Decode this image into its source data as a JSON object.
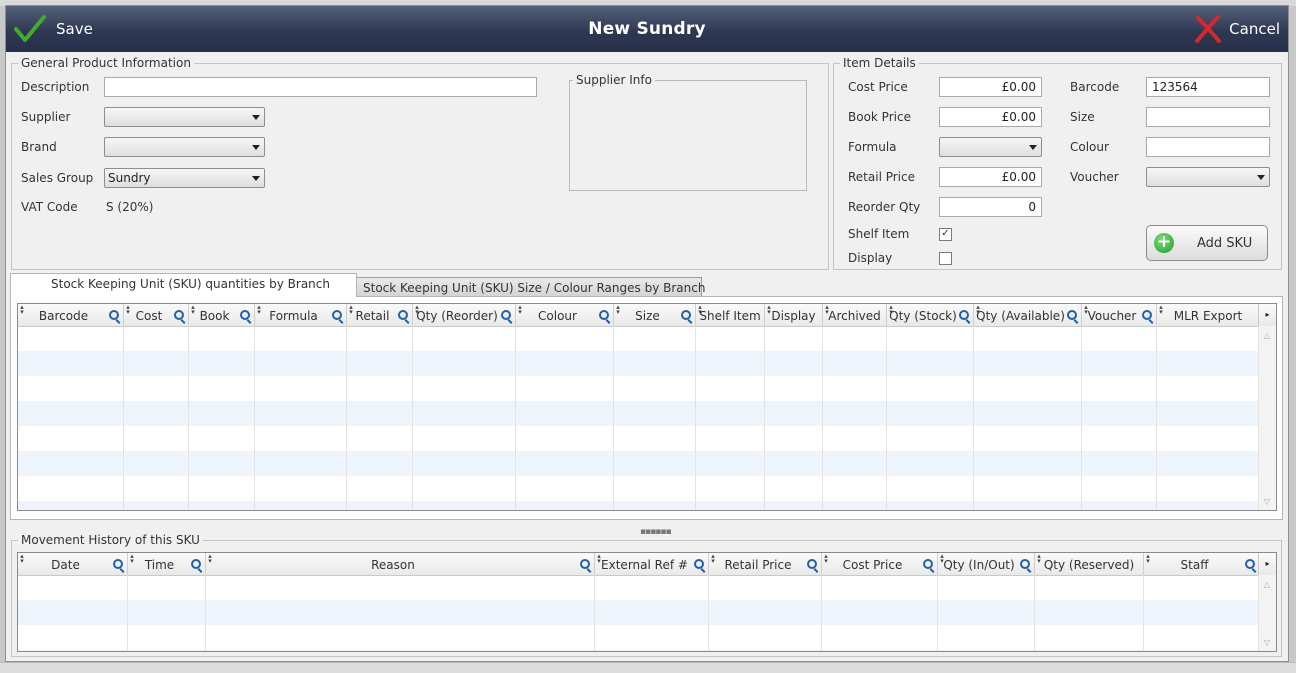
{
  "window": {
    "title": "New Sundry",
    "save_label": "Save",
    "cancel_label": "Cancel"
  },
  "general_info": {
    "group_title": "General Product Information",
    "description_label": "Description",
    "description_value": "",
    "supplier_label": "Supplier",
    "supplier_value": "",
    "brand_label": "Brand",
    "brand_value": "",
    "sales_group_label": "Sales Group",
    "sales_group_value": "Sundry",
    "vat_code_label": "VAT Code",
    "vat_code_value": "S (20%)",
    "supplier_info_title": "Supplier Info"
  },
  "item_details": {
    "group_title": "Item Details",
    "cost_price_label": "Cost Price",
    "cost_price_value": "£0.00",
    "book_price_label": "Book Price",
    "book_price_value": "£0.00",
    "formula_label": "Formula",
    "formula_value": "",
    "retail_price_label": "Retail Price",
    "retail_price_value": "£0.00",
    "reorder_qty_label": "Reorder Qty",
    "reorder_qty_value": "0",
    "shelf_item_label": "Shelf Item",
    "shelf_item_checked": true,
    "display_label": "Display",
    "display_checked": false,
    "barcode_label": "Barcode",
    "barcode_value": "123564",
    "size_label": "Size",
    "size_value": "",
    "colour_label": "Colour",
    "colour_value": "",
    "voucher_label": "Voucher",
    "voucher_value": "",
    "add_sku_label": "Add SKU"
  },
  "tabs": [
    {
      "label": "Stock Keeping Unit (SKU) quantities by Branch",
      "active": true
    },
    {
      "label": "Stock Keeping Unit (SKU) Size / Colour Ranges by Branch",
      "active": false
    }
  ],
  "sku_grid": {
    "columns": [
      "Barcode",
      "Cost",
      "Book",
      "Formula",
      "Retail",
      "Qty (Reorder)",
      "Colour",
      "Size",
      "Shelf Item",
      "Display",
      "Archived",
      "Qty (Stock)",
      "Qty (Available)",
      "Voucher",
      "MLR Export"
    ],
    "searchable": [
      true,
      true,
      true,
      true,
      true,
      true,
      true,
      true,
      false,
      false,
      false,
      true,
      true,
      true,
      false
    ],
    "rows": []
  },
  "movement": {
    "group_title": "Movement History of this SKU",
    "columns": [
      "Date",
      "Time",
      "Reason",
      "External Ref #",
      "Retail Price",
      "Cost Price",
      "Qty (In/Out)",
      "Qty (Reserved)",
      "Staff"
    ],
    "searchable": [
      true,
      true,
      true,
      true,
      true,
      true,
      true,
      false,
      true
    ],
    "rows": []
  },
  "colors": {
    "titlebar": "#2e3852",
    "row_stripe": "#eef4fc",
    "save_check": "#3fae2a",
    "cancel_x": "#d9262c"
  },
  "icons": [
    "checkmark-icon",
    "cancel-x-icon",
    "add-plus-icon",
    "search-icon",
    "sort-icon",
    "dropdown-arrow-icon"
  ]
}
